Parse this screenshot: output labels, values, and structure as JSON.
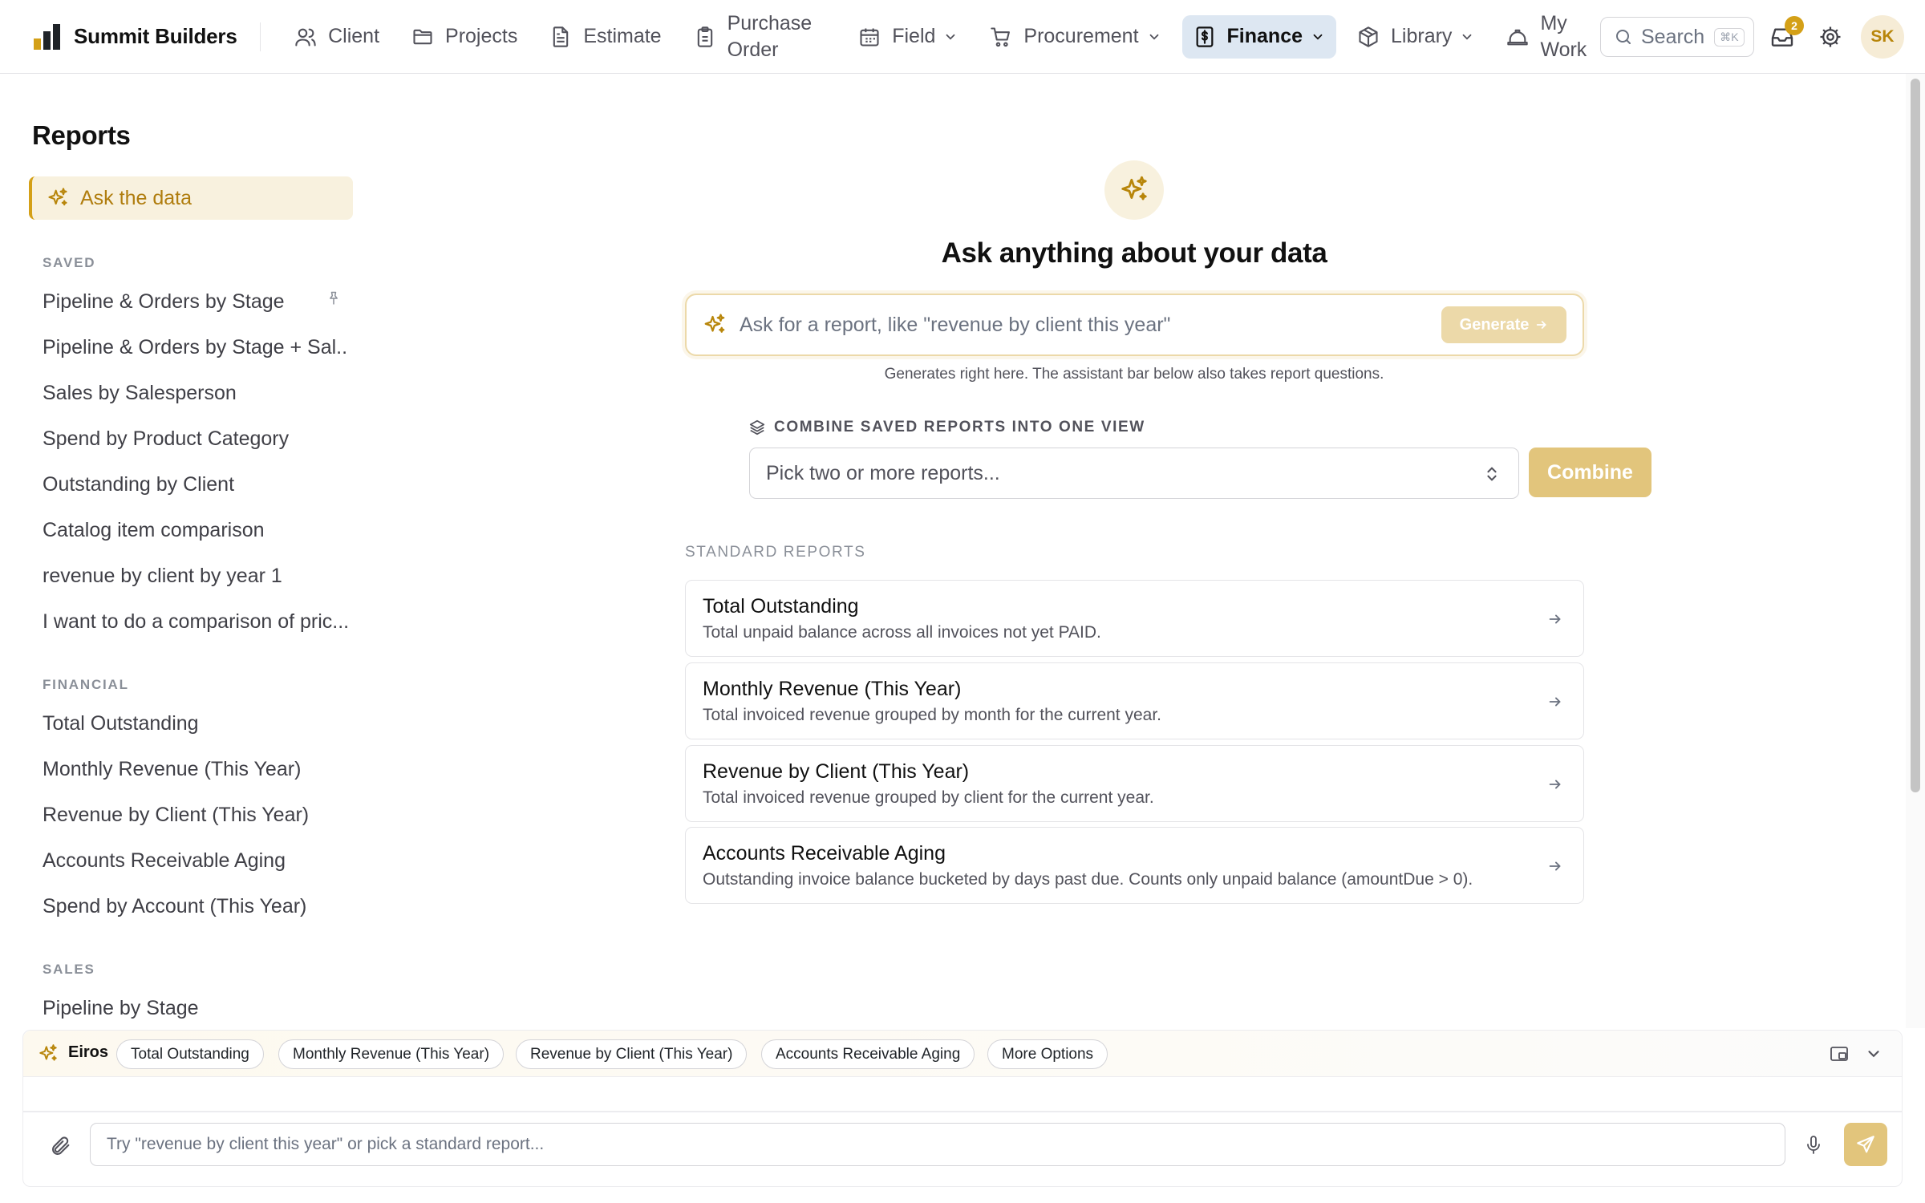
{
  "brand": {
    "name": "Summit Builders"
  },
  "nav": {
    "items": [
      {
        "label": "Client",
        "icon": "users-icon"
      },
      {
        "label": "Projects",
        "icon": "folder-icon"
      },
      {
        "label": "Estimate",
        "icon": "document-icon"
      },
      {
        "label_line1": "Purchase",
        "label_line2": "Order",
        "icon": "clipboard-icon"
      },
      {
        "label": "Field",
        "icon": "calendar-icon",
        "dropdown": true
      },
      {
        "label": "Procurement",
        "icon": "cart-icon",
        "dropdown": true
      },
      {
        "label": "Finance",
        "icon": "dollar-document-icon",
        "dropdown": true,
        "active": true
      },
      {
        "label": "Library",
        "icon": "box-icon",
        "dropdown": true
      },
      {
        "label_line1": "My",
        "label_line2": "Work",
        "icon": "hard-hat-icon"
      }
    ],
    "search_label": "Search",
    "search_shortcut": "⌘K",
    "inbox_count": "2",
    "avatar_initials": "SK"
  },
  "sidebar": {
    "title": "Reports",
    "ask_item": "Ask the data",
    "sections": [
      {
        "heading": "SAVED",
        "items": [
          "Pipeline & Orders by Stage",
          "Pipeline & Orders by Stage + Sal...",
          "Sales by Salesperson",
          "Spend by Product Category",
          "Outstanding by Client",
          "Catalog item comparison",
          "revenue by client by year 1",
          "I want to do a comparison of pric..."
        ]
      },
      {
        "heading": "FINANCIAL",
        "items": [
          "Total Outstanding",
          "Monthly Revenue (This Year)",
          "Revenue by Client (This Year)",
          "Accounts Receivable Aging",
          "Spend by Account (This Year)"
        ]
      },
      {
        "heading": "SALES",
        "items": [
          "Pipeline by Stage"
        ]
      }
    ]
  },
  "main": {
    "title": "Ask anything about your data",
    "ask_placeholder": "Ask for a report, like \"revenue by client this year\"",
    "generate_label": "Generate",
    "hint": "Generates right here. The assistant bar below also takes report questions.",
    "combine_heading": "COMBINE SAVED REPORTS INTO ONE VIEW",
    "combine_placeholder": "Pick two or more reports...",
    "combine_label": "Combine",
    "standard_heading": "STANDARD REPORTS",
    "standard_reports": [
      {
        "title": "Total Outstanding",
        "desc": "Total unpaid balance across all invoices not yet PAID."
      },
      {
        "title": "Monthly Revenue (This Year)",
        "desc": "Total invoiced revenue grouped by month for the current year."
      },
      {
        "title": "Revenue by Client (This Year)",
        "desc": "Total invoiced revenue grouped by client for the current year."
      },
      {
        "title": "Accounts Receivable Aging",
        "desc": "Outstanding invoice balance bucketed by days past due. Counts only unpaid balance (amountDue > 0)."
      }
    ]
  },
  "assistant": {
    "name": "Eiros",
    "chips": [
      "Total Outstanding",
      "Monthly Revenue (This Year)",
      "Revenue by Client (This Year)",
      "Accounts Receivable Aging",
      "More Options"
    ],
    "input_placeholder": "Try \"revenue by client this year\" or pick a standard report..."
  },
  "colors": {
    "accent": "#d4a017",
    "accent_soft": "#f8f1de",
    "active_nav": "#dde7f2",
    "button_disabled": "#e2c57c"
  }
}
